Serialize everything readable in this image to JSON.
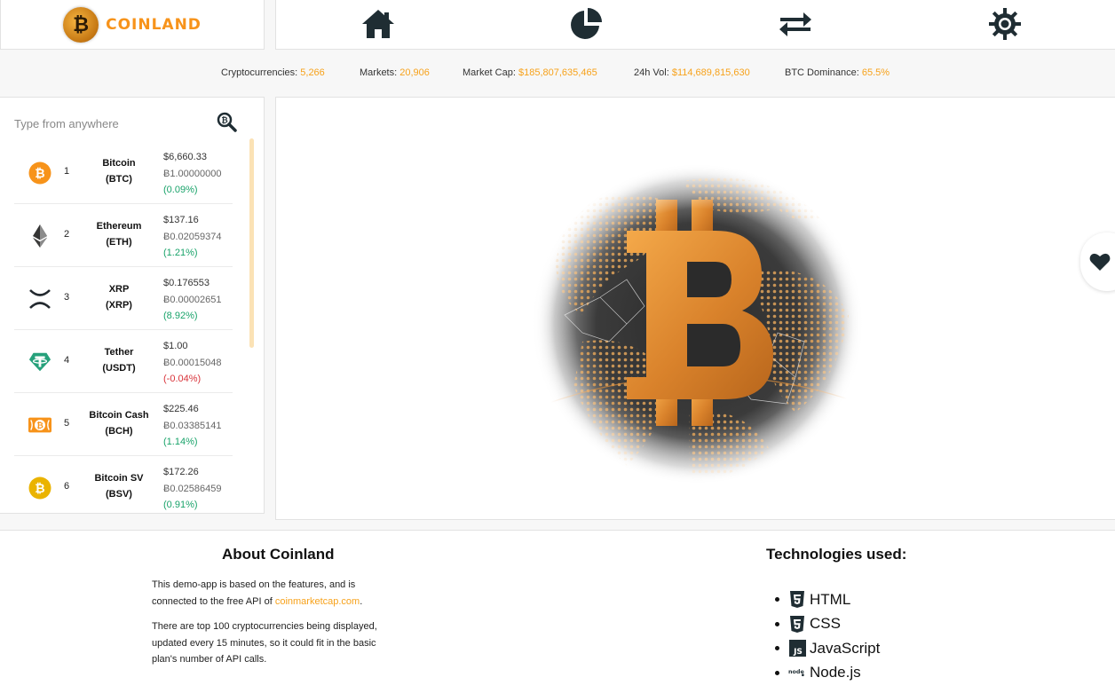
{
  "brand": {
    "name": "COINLAND",
    "coin_glyph": "₿"
  },
  "nav": [
    {
      "icon": "home-icon"
    },
    {
      "icon": "pie-chart-icon"
    },
    {
      "icon": "exchange-arrows-icon"
    },
    {
      "icon": "settings-gear-icon"
    }
  ],
  "stats": {
    "cryptocurrencies_label": "Cryptocurrencies:",
    "cryptocurrencies_value": "5,266",
    "markets_label": "Markets:",
    "markets_value": "20,906",
    "market_cap_label": "Market Cap:",
    "market_cap_value": "$185,807,635,465",
    "vol_label": "24h Vol:",
    "vol_value": "$114,689,815,630",
    "dominance_label": "BTC Dominance:",
    "dominance_value": "65.5%"
  },
  "search": {
    "placeholder": "Type from anywhere"
  },
  "coins": [
    {
      "rank": "1",
      "name": "Bitcoin",
      "symbol": "(BTC)",
      "usd": "$6,660.33",
      "btc": "Ƀ1.00000000",
      "change": "(0.09%)",
      "trend": "up",
      "icon": "bitcoin-icon"
    },
    {
      "rank": "2",
      "name": "Ethereum",
      "symbol": "(ETH)",
      "usd": "$137.16",
      "btc": "Ƀ0.02059374",
      "change": "(1.21%)",
      "trend": "up",
      "icon": "ethereum-icon"
    },
    {
      "rank": "3",
      "name": "XRP",
      "symbol": "(XRP)",
      "usd": "$0.176553",
      "btc": "Ƀ0.00002651",
      "change": "(8.92%)",
      "trend": "up",
      "icon": "xrp-icon"
    },
    {
      "rank": "4",
      "name": "Tether",
      "symbol": "(USDT)",
      "usd": "$1.00",
      "btc": "Ƀ0.00015048",
      "change": "(-0.04%)",
      "trend": "down",
      "icon": "tether-icon"
    },
    {
      "rank": "5",
      "name": "Bitcoin Cash",
      "symbol": "(BCH)",
      "usd": "$225.46",
      "btc": "Ƀ0.03385141",
      "change": "(1.14%)",
      "trend": "up",
      "icon": "bitcoin-cash-icon"
    },
    {
      "rank": "6",
      "name": "Bitcoin SV",
      "symbol": "(BSV)",
      "usd": "$172.26",
      "btc": "Ƀ0.02586459",
      "change": "(0.91%)",
      "trend": "up",
      "icon": "bitcoin-sv-icon"
    }
  ],
  "hero": {
    "icon": "bitcoin-globe-illustration"
  },
  "favorites": {
    "icon": "heart-icon"
  },
  "about": {
    "title": "About Coinland",
    "p1_text": "This demo-app is based on the features, and is connected to the free API of ",
    "p1_link": "coinmarketcap.com",
    "p1_end": ".",
    "p2": "There are top 100 cryptocurrencies being displayed, updated every 15 minutes, so it could fit in the basic plan's number of API calls."
  },
  "technologies": {
    "title": "Technologies used:",
    "items": [
      {
        "label": "HTML",
        "icon": "html5-icon"
      },
      {
        "label": "CSS",
        "icon": "css3-icon"
      },
      {
        "label": "JavaScript",
        "icon": "javascript-icon"
      },
      {
        "label": "Node.js",
        "icon": "nodejs-icon"
      }
    ]
  },
  "colors": {
    "accent": "#f7a21b",
    "up": "#19a36a",
    "down": "#d9333a",
    "bitcoin": "#f7931a",
    "tether": "#26a17b"
  }
}
